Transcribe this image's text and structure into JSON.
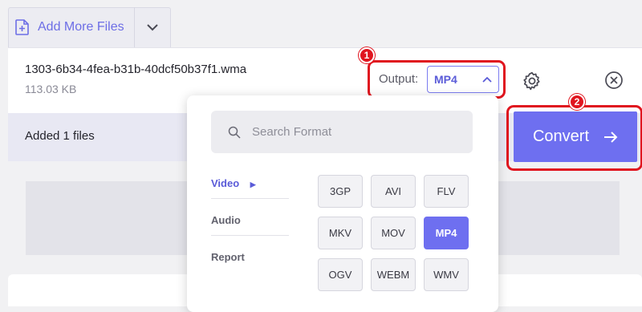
{
  "toolbar": {
    "add_files_label": "Add More Files"
  },
  "file": {
    "name": "1303-6b34-4fea-b31b-40dcf50b37f1.wma",
    "size": "113.03 KB"
  },
  "output": {
    "label": "Output:",
    "value": "MP4"
  },
  "status": {
    "text": "Added 1 files"
  },
  "convert": {
    "label": "Convert"
  },
  "annotations": {
    "badge1": "1",
    "badge2": "2"
  },
  "format_popup": {
    "search_placeholder": "Search Format",
    "categories": [
      "Video",
      "Audio",
      "Report"
    ],
    "active_category": "Video",
    "formats": [
      "3GP",
      "AVI",
      "FLV",
      "MKV",
      "MOV",
      "MP4",
      "OGV",
      "WEBM",
      "WMV"
    ],
    "selected_format": "MP4"
  },
  "colors": {
    "accent": "#6e6ff0",
    "highlight": "#e0151f"
  }
}
